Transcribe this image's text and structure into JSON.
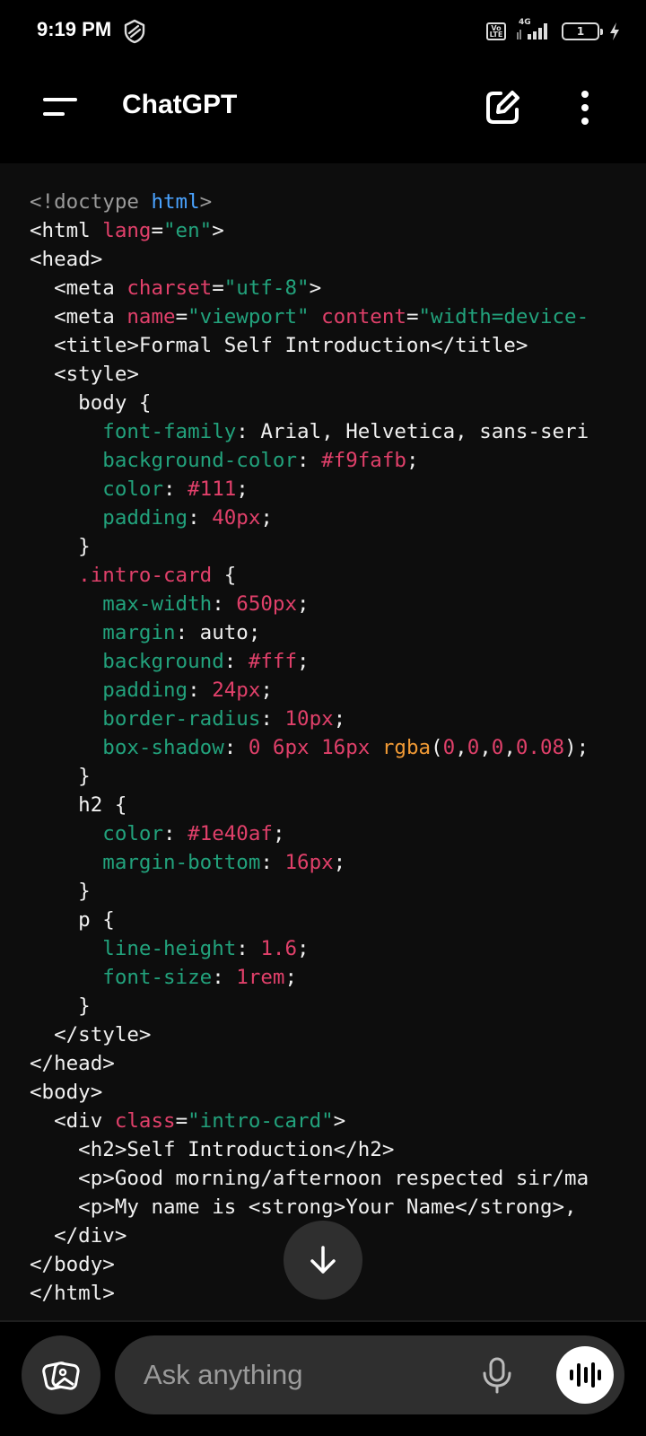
{
  "status_bar": {
    "time": "9:19 PM",
    "volte": "Vo LTE",
    "network": "4G",
    "battery_level": "1",
    "icons": [
      "vpn-icon",
      "volte-icon",
      "signal-icon",
      "battery-icon",
      "charging-icon"
    ]
  },
  "header": {
    "title": "ChatGPT",
    "icons": [
      "menu-icon",
      "new-chat-icon",
      "more-vert-icon"
    ]
  },
  "code": {
    "language": "html",
    "lines": [
      [
        [
          "c",
          "<!doctype "
        ],
        [
          "b",
          "html"
        ],
        [
          "c",
          ">"
        ]
      ],
      [
        [
          "w",
          "<html "
        ],
        [
          "r",
          "lang"
        ],
        [
          "w",
          "="
        ],
        [
          "g",
          "\"en\""
        ],
        [
          "w",
          ">"
        ]
      ],
      [
        [
          "w",
          "<head>"
        ]
      ],
      [
        [
          "w",
          "  <meta "
        ],
        [
          "r",
          "charset"
        ],
        [
          "w",
          "="
        ],
        [
          "g",
          "\"utf-8\""
        ],
        [
          "w",
          ">"
        ]
      ],
      [
        [
          "w",
          "  <meta "
        ],
        [
          "r",
          "name"
        ],
        [
          "w",
          "="
        ],
        [
          "g",
          "\"viewport\""
        ],
        [
          "w",
          " "
        ],
        [
          "r",
          "content"
        ],
        [
          "w",
          "="
        ],
        [
          "g",
          "\"width=device-"
        ]
      ],
      [
        [
          "w",
          "  <title>Formal Self Introduction</title>"
        ]
      ],
      [
        [
          "w",
          "  <style>"
        ]
      ],
      [
        [
          "w",
          "    body {"
        ]
      ],
      [
        [
          "w",
          "      "
        ],
        [
          "g",
          "font-family"
        ],
        [
          "w",
          ": Arial, Helvetica, sans-seri"
        ]
      ],
      [
        [
          "w",
          "      "
        ],
        [
          "g",
          "background-color"
        ],
        [
          "w",
          ": "
        ],
        [
          "r",
          "#f9fafb"
        ],
        [
          "w",
          ";"
        ]
      ],
      [
        [
          "w",
          "      "
        ],
        [
          "g",
          "color"
        ],
        [
          "w",
          ": "
        ],
        [
          "r",
          "#111"
        ],
        [
          "w",
          ";"
        ]
      ],
      [
        [
          "w",
          "      "
        ],
        [
          "g",
          "padding"
        ],
        [
          "w",
          ": "
        ],
        [
          "r",
          "40px"
        ],
        [
          "w",
          ";"
        ]
      ],
      [
        [
          "w",
          "    }"
        ]
      ],
      [
        [
          "w",
          "    "
        ],
        [
          "r",
          ".intro-card"
        ],
        [
          "w",
          " {"
        ]
      ],
      [
        [
          "w",
          "      "
        ],
        [
          "g",
          "max-width"
        ],
        [
          "w",
          ": "
        ],
        [
          "r",
          "650px"
        ],
        [
          "w",
          ";"
        ]
      ],
      [
        [
          "w",
          "      "
        ],
        [
          "g",
          "margin"
        ],
        [
          "w",
          ": auto;"
        ]
      ],
      [
        [
          "w",
          "      "
        ],
        [
          "g",
          "background"
        ],
        [
          "w",
          ": "
        ],
        [
          "r",
          "#fff"
        ],
        [
          "w",
          ";"
        ]
      ],
      [
        [
          "w",
          "      "
        ],
        [
          "g",
          "padding"
        ],
        [
          "w",
          ": "
        ],
        [
          "r",
          "24px"
        ],
        [
          "w",
          ";"
        ]
      ],
      [
        [
          "w",
          "      "
        ],
        [
          "g",
          "border-radius"
        ],
        [
          "w",
          ": "
        ],
        [
          "r",
          "10px"
        ],
        [
          "w",
          ";"
        ]
      ],
      [
        [
          "w",
          "      "
        ],
        [
          "g",
          "box-shadow"
        ],
        [
          "w",
          ": "
        ],
        [
          "r",
          "0 6px 16px"
        ],
        [
          "w",
          " "
        ],
        [
          "o",
          "rgba"
        ],
        [
          "w",
          "("
        ],
        [
          "r",
          "0"
        ],
        [
          "w",
          ","
        ],
        [
          "r",
          "0"
        ],
        [
          "w",
          ","
        ],
        [
          "r",
          "0"
        ],
        [
          "w",
          ","
        ],
        [
          "r",
          "0.08"
        ],
        [
          "w",
          ");"
        ]
      ],
      [
        [
          "w",
          "    }"
        ]
      ],
      [
        [
          "w",
          "    h2 {"
        ]
      ],
      [
        [
          "w",
          "      "
        ],
        [
          "g",
          "color"
        ],
        [
          "w",
          ": "
        ],
        [
          "r",
          "#1e40af"
        ],
        [
          "w",
          ";"
        ]
      ],
      [
        [
          "w",
          "      "
        ],
        [
          "g",
          "margin-bottom"
        ],
        [
          "w",
          ": "
        ],
        [
          "r",
          "16px"
        ],
        [
          "w",
          ";"
        ]
      ],
      [
        [
          "w",
          "    }"
        ]
      ],
      [
        [
          "w",
          "    p {"
        ]
      ],
      [
        [
          "w",
          "      "
        ],
        [
          "g",
          "line-height"
        ],
        [
          "w",
          ": "
        ],
        [
          "r",
          "1.6"
        ],
        [
          "w",
          ";"
        ]
      ],
      [
        [
          "w",
          "      "
        ],
        [
          "g",
          "font-size"
        ],
        [
          "w",
          ": "
        ],
        [
          "r",
          "1rem"
        ],
        [
          "w",
          ";"
        ]
      ],
      [
        [
          "w",
          "    }"
        ]
      ],
      [
        [
          "w",
          "  </style>"
        ]
      ],
      [
        [
          "w",
          "</head>"
        ]
      ],
      [
        [
          "w",
          "<body>"
        ]
      ],
      [
        [
          "w",
          "  <div "
        ],
        [
          "r",
          "class"
        ],
        [
          "w",
          "="
        ],
        [
          "g",
          "\"intro-card\""
        ],
        [
          "w",
          ">"
        ]
      ],
      [
        [
          "w",
          "    <h2>Self Introduction</h2>"
        ]
      ],
      [
        [
          "w",
          "    <p>Good morning/afternoon respected sir/ma"
        ]
      ],
      [
        [
          "w",
          "    <p>My name is <strong>Your Name</strong>,"
        ]
      ],
      [
        [
          "w",
          "  </div>"
        ]
      ],
      [
        [
          "w",
          "</body>"
        ]
      ],
      [
        [
          "w",
          "</html>"
        ]
      ]
    ]
  },
  "composer": {
    "placeholder": "Ask anything",
    "icons": [
      "attach-image-icon",
      "mic-icon",
      "voice-mode-icon"
    ]
  },
  "scroll_button_icon": "arrow-down-icon",
  "colors": {
    "background": "#000000",
    "code_background": "#0d0d0d",
    "pill": "#2f2f2f",
    "syntax_tag": "#f0f0f0",
    "syntax_doctype": "#9a9a9a",
    "syntax_keyword_blue": "#4aa3ff",
    "syntax_attr_red": "#e0406a",
    "syntax_string_green": "#22a27c",
    "syntax_function_orange": "#f19a35"
  }
}
